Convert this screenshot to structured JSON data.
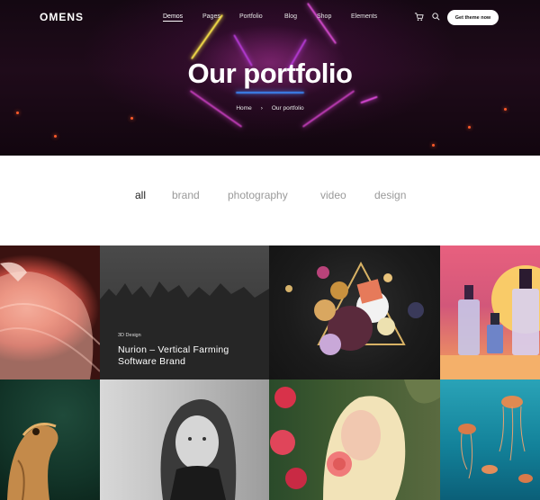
{
  "brand": {
    "logo": "OMENS"
  },
  "nav": {
    "items": [
      {
        "label": "Demos",
        "active": true
      },
      {
        "label": "Pages",
        "active": false
      },
      {
        "label": "Portfolio",
        "active": false
      },
      {
        "label": "Blog",
        "active": false
      },
      {
        "label": "Shop",
        "active": false
      },
      {
        "label": "Elements",
        "active": false
      }
    ],
    "icons": [
      "cart-icon",
      "search-icon"
    ],
    "cta_label": "Get theme now"
  },
  "hero": {
    "title": "Our portfolio",
    "breadcrumb": {
      "home": "Home",
      "separator": "›",
      "current": "Our portfolio"
    }
  },
  "filters": [
    {
      "label": "all",
      "active": true
    },
    {
      "label": "brand",
      "active": false
    },
    {
      "label": "photography",
      "active": false
    },
    {
      "label": "video",
      "active": false
    },
    {
      "label": "design",
      "active": false
    }
  ],
  "portfolio": {
    "featured": {
      "category": "3D Design",
      "title_line1": "Nurion – Vertical Farming",
      "title_line2": "Software Brand"
    },
    "tiles": [
      "flamingo",
      "foggy-forest",
      "3d-spheres",
      "cosmetic-bottles",
      "lizard",
      "woman-portrait",
      "woman-with-flower",
      "jellyfish"
    ]
  },
  "colors": {
    "hero_bg": "#1a0a16",
    "accent_magenta": "#c53cc0",
    "spark_orange": "#ff5a2a",
    "filter_inactive": "#9a9a9a",
    "filter_active": "#222222"
  }
}
